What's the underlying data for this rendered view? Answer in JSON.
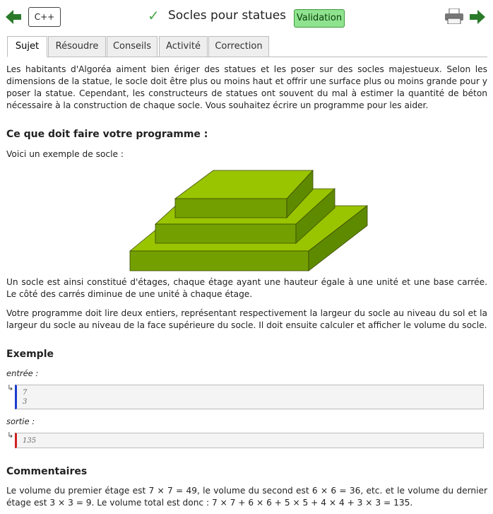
{
  "header": {
    "language": "C++",
    "title": "Socles pour statues",
    "validation_label": "Validation"
  },
  "tabs": [
    {
      "label": "Sujet",
      "active": true
    },
    {
      "label": "Résoudre",
      "active": false
    },
    {
      "label": "Conseils",
      "active": false
    },
    {
      "label": "Activité",
      "active": false
    },
    {
      "label": "Correction",
      "active": false
    }
  ],
  "content": {
    "intro": "Les habitants d'Algoréa aiment bien ériger des statues et les poser sur des socles majestueux. Selon les dimensions de la statue, le socle doit être plus ou moins haut et offrir une surface plus ou moins grande pour y poser la statue. Cependant, les constructeurs de statues ont souvent du mal à estimer la quantité de béton nécessaire à la construction de chaque socle. Vous souhaitez écrire un programme pour les aider.",
    "section_task": "Ce que doit faire votre programme :",
    "example_intro": "Voici un exemple de socle :",
    "description": "Un socle est ainsi constitué d'étages, chaque étage ayant une hauteur égale à une unité et une base carrée. Le côté des carrés diminue de une unité à chaque étage.",
    "program": "Votre programme doit lire deux entiers, représentant respectivement la largeur du socle au niveau du sol et la largeur du socle au niveau de la face supérieure du socle. Il doit ensuite calculer et afficher le volume du socle.",
    "section_example": "Exemple",
    "input_label": "entrée :",
    "input_lines": [
      "7",
      "3"
    ],
    "output_label": "sortie :",
    "output_lines": [
      "135"
    ],
    "section_comments": "Commentaires",
    "comment": "Le volume du premier étage est 7 × 7 = 49, le volume du second est 6 × 6 = 36, etc. et le volume du dernier étage est 3 × 3 = 9. Le volume total est donc : 7 × 7 + 6 × 6 + 5 × 5 + 4 × 4 + 3 × 3 = 135."
  },
  "colors": {
    "accent_green": "#8fe38f",
    "input_bar": "#1a3ccf",
    "output_bar": "#d02020",
    "pedestal_top": "#99c400",
    "pedestal_front": "#73a000",
    "pedestal_side": "#5e8a00"
  },
  "icons": [
    "arrow-left-icon",
    "check-icon",
    "print-icon",
    "arrow-right-icon"
  ]
}
